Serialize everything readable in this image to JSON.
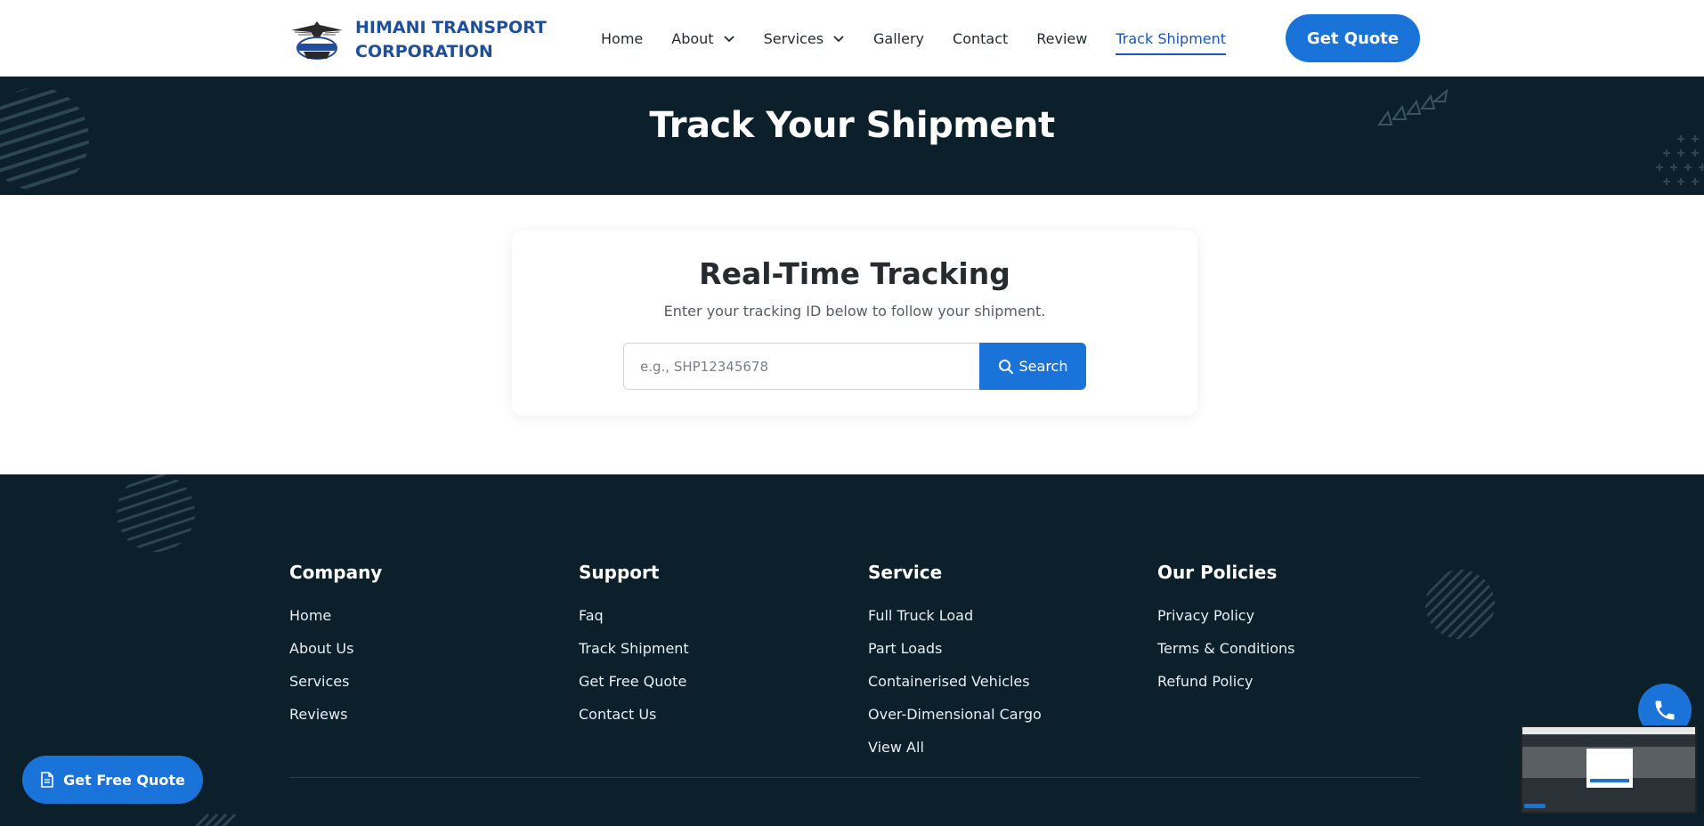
{
  "header": {
    "brand_line1": "HIMANI TRANSPORT",
    "brand_line2": "CORPORATION",
    "nav": [
      {
        "label": "Home",
        "dropdown": false
      },
      {
        "label": "About",
        "dropdown": true
      },
      {
        "label": "Services",
        "dropdown": true
      },
      {
        "label": "Gallery",
        "dropdown": false
      },
      {
        "label": "Contact",
        "dropdown": false
      },
      {
        "label": "Review",
        "dropdown": false
      },
      {
        "label": "Track Shipment",
        "dropdown": false,
        "active": true
      }
    ],
    "cta_label": "Get Quote"
  },
  "hero": {
    "title": "Track Your Shipment"
  },
  "tracking": {
    "title": "Real-Time Tracking",
    "subtitle": "Enter your tracking ID below to follow your shipment.",
    "input_placeholder": "e.g., SHP12345678",
    "input_value": "",
    "search_label": "Search"
  },
  "footer": {
    "columns": [
      {
        "title": "Company",
        "links": [
          "Home",
          "About Us",
          "Services",
          "Reviews"
        ]
      },
      {
        "title": "Support",
        "links": [
          "Faq",
          "Track Shipment",
          "Get Free Quote",
          "Contact Us"
        ]
      },
      {
        "title": "Service",
        "links": [
          "Full Truck Load",
          "Part Loads",
          "Containerised Vehicles",
          "Over-Dimensional Cargo",
          "View All"
        ]
      },
      {
        "title": "Our Policies",
        "links": [
          "Privacy Policy",
          "Terms & Conditions",
          "Refund Policy"
        ]
      }
    ]
  },
  "floating": {
    "free_quote_label": "Get Free Quote",
    "phone_icon": "phone-icon"
  },
  "colors": {
    "accent": "#1a73d9",
    "brand_text": "#1f4e9c",
    "dark_bg": "#0b202a"
  }
}
